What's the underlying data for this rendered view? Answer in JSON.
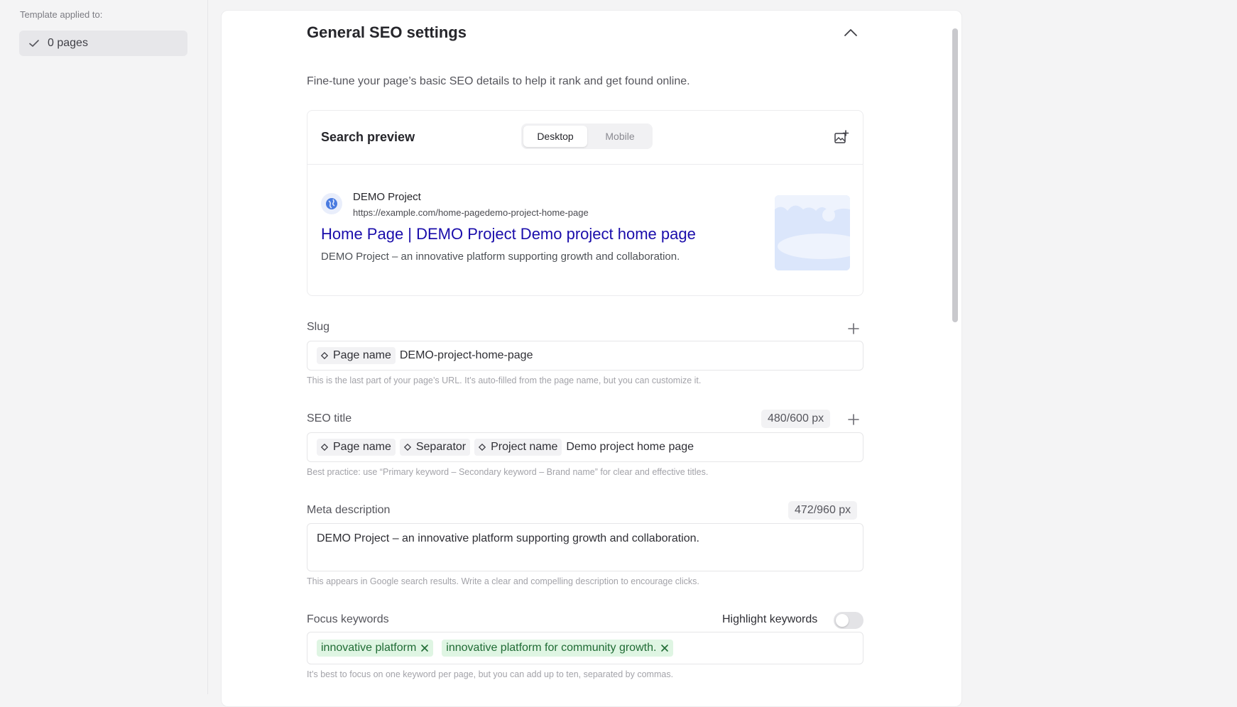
{
  "sidebar": {
    "template_label": "Template applied to:",
    "pages_count": "0 pages"
  },
  "section": {
    "title": "General SEO settings",
    "description": "Fine-tune your page’s basic SEO details to help it rank and get found online."
  },
  "preview": {
    "title": "Search preview",
    "modes": [
      "Desktop",
      "Mobile"
    ],
    "active_mode": "Desktop",
    "site_name": "DEMO Project",
    "url": "https://example.com/home-pagedemo-project-home-page",
    "result_title": "Home Page | DEMO Project Demo project home page",
    "result_description": "DEMO Project – an innovative platform supporting growth and collaboration."
  },
  "slug": {
    "label": "Slug",
    "chip": "Page name",
    "value": "DEMO-project-home-page",
    "hint": "This is the last part of your page’s URL. It’s auto-filled from the page name, but you can customize it."
  },
  "seo_title": {
    "label": "SEO title",
    "counter": "480/600 px",
    "chips": [
      "Page name",
      "Separator",
      "Project name"
    ],
    "value": "Demo project home page",
    "hint": "Best practice: use “Primary keyword – Secondary keyword – Brand name” for clear and effective titles."
  },
  "meta_description": {
    "label": "Meta description",
    "counter": "472/960 px",
    "value": "DEMO Project – an innovative platform supporting growth and collaboration.",
    "hint": "This appears in Google search results. Write a clear and compelling description to encourage clicks."
  },
  "focus_keywords": {
    "label": "Focus keywords",
    "toggle_label": "Highlight keywords",
    "toggle_on": false,
    "keywords": [
      "innovative platform",
      "innovative platform for community growth."
    ],
    "hint": "It’s best to focus on one keyword per page, but you can add up to ten, separated by commas."
  },
  "colors": {
    "link": "#1a0dab",
    "keyword_bg": "#dff5e3",
    "keyword_text": "#1f6b34"
  }
}
